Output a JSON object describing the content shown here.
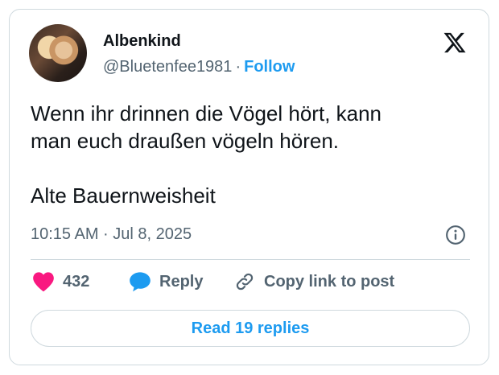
{
  "author": {
    "name": "Albenkind",
    "handle": "@Bluetenfee1981",
    "separator": "·",
    "follow_label": "Follow",
    "avatar_icon": "profile-photo"
  },
  "brand": {
    "logo_icon": "x-logo"
  },
  "tweet": {
    "text": "Wenn ihr drinnen die Vögel hört, kann\nman euch draußen vögeln hören.\n\nAlte Bauernweisheit",
    "timestamp": "10:15 AM · Jul 8, 2025",
    "info_icon": "info-icon"
  },
  "actions": {
    "like_count": "432",
    "like_icon": "heart-icon",
    "reply_label": "Reply",
    "reply_icon": "speech-bubble-icon",
    "copy_label": "Copy link to post",
    "copy_icon": "link-icon"
  },
  "replies_button": "Read 19 replies",
  "colors": {
    "accent": "#1d9bf0",
    "like": "#f91880",
    "text": "#0f1419",
    "muted": "#536471",
    "border": "#cfd9de"
  }
}
